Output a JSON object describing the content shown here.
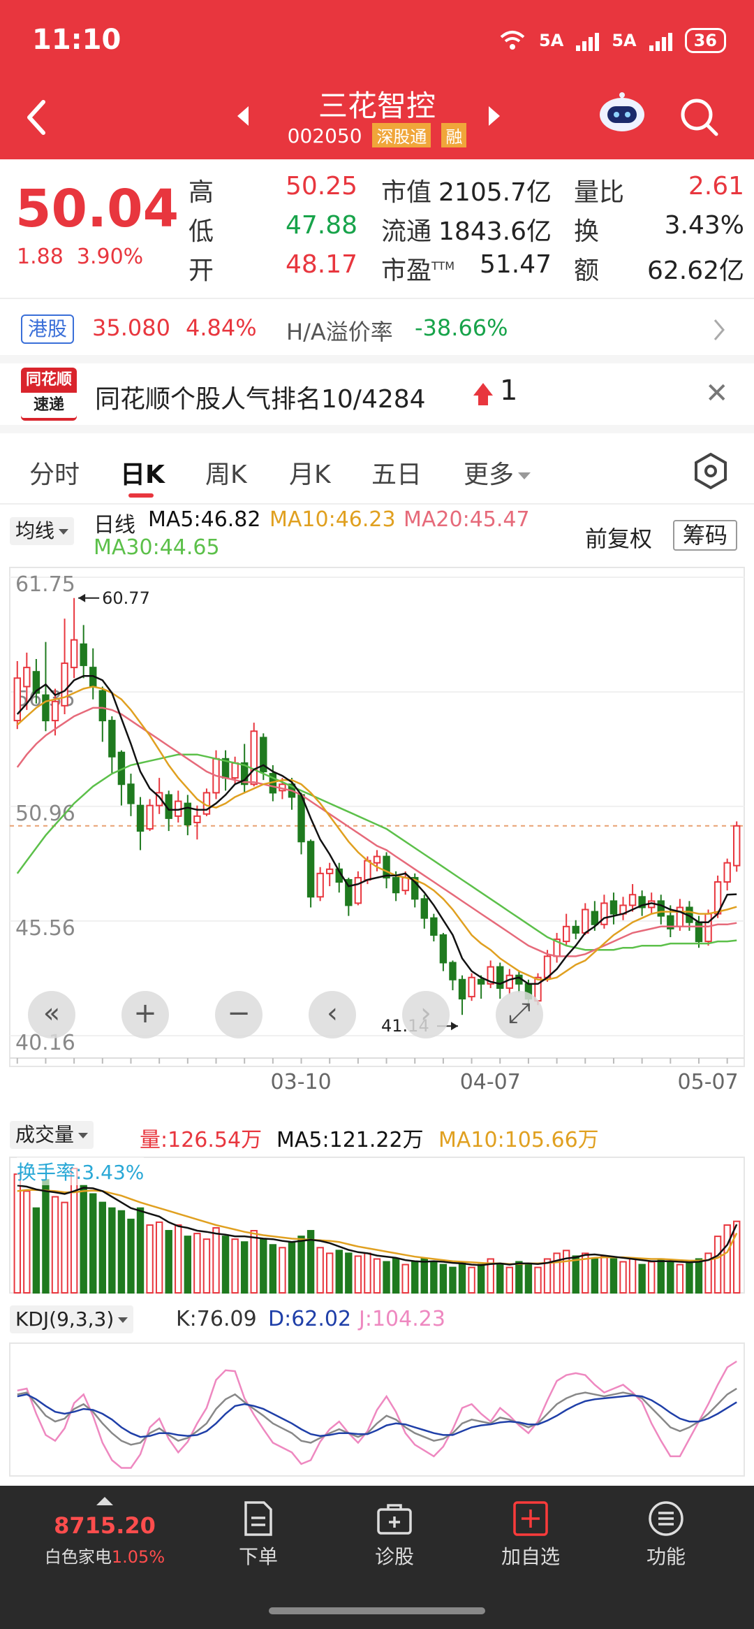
{
  "status": {
    "time": "11:10",
    "net1": "5A",
    "net2": "5A",
    "battery": "36"
  },
  "header": {
    "stock_name": "三花智控",
    "stock_code": "002050",
    "tag_connect": "深股通",
    "tag_margin": "融"
  },
  "quote": {
    "price": "50.04",
    "change": "1.88",
    "change_pct": "3.90%",
    "high_label": "高",
    "high": "50.25",
    "low_label": "低",
    "low": "47.88",
    "open_label": "开",
    "open": "48.17",
    "mktcap_label": "市值",
    "mktcap": "2105.7亿",
    "float_label": "流通",
    "float": "1843.6亿",
    "pe_label": "市盈",
    "pe_sup": "TTM",
    "pe": "51.47",
    "volratio_label": "量比",
    "volratio": "2.61",
    "turnover_label": "换",
    "turnover": "3.43%",
    "amount_label": "额",
    "amount": "62.62亿"
  },
  "hk": {
    "badge": "港股",
    "price": "35.080",
    "pct": "4.84%",
    "premium_label": "H/A溢价率",
    "premium": "-38.66%"
  },
  "popularity": {
    "logo_top": "同花顺",
    "logo_bottom": "速递",
    "text": "同花顺个股人气排名10/4284",
    "rank_change": "1"
  },
  "tabs": [
    "分时",
    "日K",
    "周K",
    "月K",
    "五日",
    "更多"
  ],
  "ma_legend": {
    "dropdown": "均线",
    "period": "日线",
    "ma5": "MA5:46.82",
    "ma10": "MA10:46.23",
    "ma20": "MA20:45.47",
    "ma30": "MA30:44.65",
    "adjust": "前复权",
    "chips": "筹码"
  },
  "colors": {
    "up": "#e8363e",
    "down": "#1f7a1f",
    "ma5": "#111111",
    "ma10": "#e0a020",
    "ma20": "#e66a7a",
    "ma30": "#5cc04a",
    "kdj_k": "#888888",
    "kdj_d": "#1f3fa8",
    "kdj_j": "#ee88c0"
  },
  "chart_data": [
    {
      "type": "candlestick",
      "title": "日线",
      "yticks": [
        "61.75",
        "56.35",
        "50.96",
        "45.56",
        "40.16"
      ],
      "ylim": [
        40.16,
        61.75
      ],
      "xticks": [
        "03-10",
        "04-07",
        "05-07"
      ],
      "high_marker": "60.77",
      "low_marker": "41.14",
      "last_close": 50.04,
      "candles": [
        [
          55.0,
          57.0,
          54.6,
          57.8
        ],
        [
          56.6,
          57.5,
          55.5,
          58.2
        ],
        [
          57.3,
          56.3,
          55.8,
          57.9
        ],
        [
          56.2,
          55.0,
          54.5,
          58.7
        ],
        [
          55.0,
          55.9,
          54.3,
          56.5
        ],
        [
          55.7,
          57.7,
          55.3,
          59.8
        ],
        [
          57.5,
          58.8,
          57.0,
          60.77
        ],
        [
          58.6,
          57.6,
          57.0,
          59.5
        ],
        [
          57.5,
          56.6,
          56.0,
          58.4
        ],
        [
          56.4,
          55.0,
          54.0,
          56.6
        ],
        [
          55.0,
          53.3,
          52.5,
          55.2
        ],
        [
          53.5,
          52.0,
          51.0,
          53.6
        ],
        [
          52.0,
          51.1,
          50.5,
          52.5
        ],
        [
          51.0,
          49.8,
          48.9,
          51.4
        ],
        [
          49.9,
          51.0,
          49.8,
          51.3
        ],
        [
          51.0,
          51.6,
          50.6,
          52.3
        ],
        [
          51.5,
          50.4,
          49.8,
          51.7
        ],
        [
          50.5,
          51.2,
          50.2,
          51.7
        ],
        [
          51.1,
          50.1,
          49.6,
          51.5
        ],
        [
          50.2,
          50.5,
          49.4,
          51.0
        ],
        [
          50.6,
          51.6,
          50.5,
          51.8
        ],
        [
          51.6,
          53.2,
          51.3,
          53.6
        ],
        [
          53.2,
          52.3,
          51.7,
          53.6
        ],
        [
          52.3,
          53.0,
          52.0,
          53.3
        ],
        [
          53.0,
          52.0,
          51.6,
          53.9
        ],
        [
          52.0,
          54.5,
          51.9,
          54.9
        ],
        [
          54.2,
          52.6,
          52.2,
          54.4
        ],
        [
          52.5,
          51.6,
          51.2,
          52.9
        ],
        [
          51.7,
          52.0,
          51.3,
          52.3
        ],
        [
          52.0,
          51.4,
          50.8,
          52.3
        ],
        [
          51.5,
          49.3,
          48.7,
          51.6
        ],
        [
          49.3,
          46.7,
          46.2,
          49.4
        ],
        [
          46.7,
          47.8,
          46.5,
          48.1
        ],
        [
          47.8,
          48.0,
          47.2,
          48.3
        ],
        [
          48.0,
          47.4,
          46.9,
          48.3
        ],
        [
          47.5,
          46.3,
          45.8,
          47.6
        ],
        [
          46.4,
          47.6,
          46.3,
          47.9
        ],
        [
          47.5,
          48.4,
          47.3,
          48.6
        ],
        [
          48.3,
          48.6,
          47.9,
          48.9
        ],
        [
          48.6,
          47.6,
          47.1,
          48.8
        ],
        [
          47.6,
          46.9,
          46.5,
          47.9
        ],
        [
          47.0,
          47.6,
          46.8,
          47.9
        ],
        [
          47.6,
          46.6,
          46.2,
          47.8
        ],
        [
          46.6,
          45.7,
          45.2,
          46.8
        ],
        [
          45.7,
          44.9,
          44.6,
          45.9
        ],
        [
          44.9,
          43.6,
          43.2,
          45.0
        ],
        [
          43.6,
          42.8,
          42.3,
          43.7
        ],
        [
          42.8,
          41.9,
          41.14,
          43.0
        ],
        [
          42.0,
          42.9,
          41.8,
          43.1
        ],
        [
          42.8,
          42.6,
          41.9,
          43.0
        ],
        [
          42.6,
          43.4,
          42.4,
          43.7
        ],
        [
          43.4,
          42.4,
          41.9,
          43.6
        ],
        [
          42.4,
          43.0,
          42.1,
          43.3
        ],
        [
          43.0,
          42.6,
          42.2,
          43.2
        ],
        [
          42.6,
          41.9,
          41.4,
          42.8
        ],
        [
          41.8,
          42.9,
          41.6,
          43.1
        ],
        [
          42.9,
          43.9,
          42.7,
          44.2
        ],
        [
          43.9,
          44.7,
          43.6,
          45.0
        ],
        [
          44.6,
          45.3,
          44.4,
          45.9
        ],
        [
          45.3,
          45.0,
          44.7,
          45.6
        ],
        [
          45.0,
          46.1,
          44.9,
          46.4
        ],
        [
          46.0,
          45.4,
          45.1,
          46.5
        ],
        [
          45.4,
          46.4,
          45.2,
          46.8
        ],
        [
          46.5,
          45.9,
          45.4,
          46.9
        ],
        [
          45.9,
          46.3,
          45.6,
          46.7
        ],
        [
          46.3,
          46.8,
          46.0,
          47.3
        ],
        [
          46.7,
          46.2,
          45.8,
          47.0
        ],
        [
          46.2,
          46.5,
          45.9,
          46.9
        ],
        [
          46.5,
          45.8,
          45.4,
          46.8
        ],
        [
          45.8,
          45.2,
          44.8,
          46.3
        ],
        [
          45.3,
          46.2,
          45.1,
          46.6
        ],
        [
          46.2,
          45.5,
          45.1,
          46.5
        ],
        [
          45.5,
          44.6,
          44.3,
          45.8
        ],
        [
          44.6,
          45.9,
          44.4,
          46.1
        ],
        [
          45.9,
          47.4,
          45.7,
          47.7
        ],
        [
          47.4,
          48.3,
          47.0,
          48.5
        ],
        [
          48.17,
          50.04,
          47.88,
          50.25
        ]
      ],
      "ma5": [
        55.3,
        55.8,
        56.4,
        56.7,
        56.2,
        56.4,
        56.9,
        57.1,
        57.1,
        56.9,
        56.3,
        55.1,
        53.9,
        52.6,
        51.8,
        51.4,
        50.8,
        50.8,
        50.9,
        50.8,
        50.8,
        51.1,
        51.5,
        52.0,
        52.2,
        52.7,
        52.9,
        52.6,
        52.4,
        52.1,
        51.5,
        50.4,
        49.4,
        48.7,
        47.9,
        47.2,
        47.3,
        47.5,
        47.6,
        47.7,
        47.7,
        47.8,
        47.4,
        46.9,
        46.3,
        45.6,
        44.9,
        43.8,
        43.2,
        42.9,
        42.7,
        42.6,
        42.8,
        42.9,
        42.6,
        42.6,
        42.9,
        43.3,
        43.9,
        44.4,
        45.0,
        45.3,
        45.7,
        45.8,
        45.9,
        46.1,
        46.3,
        46.4,
        46.3,
        46.1,
        46.0,
        45.8,
        45.5,
        45.5,
        45.9,
        46.8,
        46.82
      ],
      "ma10": [
        54.8,
        55.2,
        55.6,
        55.9,
        56.0,
        56.1,
        56.3,
        56.5,
        56.6,
        56.5,
        56.3,
        56.0,
        55.5,
        54.9,
        54.3,
        53.6,
        52.9,
        52.3,
        51.8,
        51.3,
        51.0,
        50.9,
        51.1,
        51.4,
        51.6,
        51.8,
        52.0,
        52.1,
        52.2,
        52.2,
        52.0,
        51.6,
        51.1,
        50.5,
        49.9,
        49.3,
        48.8,
        48.4,
        48.1,
        47.9,
        47.7,
        47.6,
        47.5,
        47.3,
        47.0,
        46.6,
        46.1,
        45.5,
        44.9,
        44.5,
        44.2,
        43.8,
        43.5,
        43.2,
        43.0,
        42.8,
        42.8,
        42.9,
        43.2,
        43.5,
        43.7,
        44.1,
        44.5,
        44.9,
        45.2,
        45.5,
        45.7,
        45.9,
        46.0,
        46.0,
        46.0,
        46.0,
        45.9,
        45.9,
        46.0,
        46.1,
        46.23
      ],
      "ma20": [
        52.8,
        53.4,
        53.9,
        54.3,
        54.6,
        54.9,
        55.2,
        55.4,
        55.6,
        55.6,
        55.5,
        55.3,
        55.0,
        54.7,
        54.4,
        54.1,
        53.8,
        53.5,
        53.2,
        52.9,
        52.6,
        52.4,
        52.3,
        52.2,
        52.1,
        52.1,
        52.0,
        51.9,
        51.8,
        51.7,
        51.5,
        51.2,
        50.9,
        50.6,
        50.3,
        50.0,
        49.7,
        49.4,
        49.1,
        48.9,
        48.6,
        48.3,
        48.0,
        47.7,
        47.4,
        47.1,
        46.8,
        46.5,
        46.2,
        45.9,
        45.6,
        45.3,
        45.0,
        44.7,
        44.4,
        44.2,
        44.0,
        43.9,
        43.9,
        43.9,
        44.0,
        44.2,
        44.4,
        44.6,
        44.8,
        45.0,
        45.1,
        45.2,
        45.3,
        45.3,
        45.3,
        45.3,
        45.3,
        45.3,
        45.4,
        45.4,
        45.47
      ],
      "ma30": [
        47.8,
        48.4,
        49.0,
        49.6,
        50.1,
        50.6,
        51.1,
        51.5,
        51.9,
        52.2,
        52.5,
        52.7,
        52.9,
        53.0,
        53.1,
        53.2,
        53.3,
        53.4,
        53.4,
        53.4,
        53.3,
        53.2,
        53.1,
        53.0,
        52.9,
        52.7,
        52.5,
        52.3,
        52.1,
        51.9,
        51.7,
        51.5,
        51.3,
        51.1,
        50.9,
        50.7,
        50.5,
        50.3,
        50.1,
        49.9,
        49.6,
        49.3,
        49.0,
        48.7,
        48.4,
        48.1,
        47.8,
        47.5,
        47.2,
        46.9,
        46.6,
        46.3,
        46.0,
        45.7,
        45.4,
        45.1,
        44.8,
        44.6,
        44.4,
        44.3,
        44.2,
        44.2,
        44.2,
        44.2,
        44.3,
        44.3,
        44.4,
        44.4,
        44.4,
        44.5,
        44.5,
        44.5,
        44.5,
        44.5,
        44.6,
        44.6,
        44.65
      ]
    },
    {
      "type": "bar",
      "title": "成交量",
      "legend": {
        "dropdown": "成交量",
        "vol": "量:126.54万",
        "ma5": "MA5:121.22万",
        "ma10": "MA10:105.66万",
        "turnover": "换手率:3.43%"
      },
      "values": [
        210,
        180,
        150,
        200,
        170,
        160,
        220,
        190,
        175,
        160,
        150,
        145,
        130,
        150,
        120,
        125,
        110,
        120,
        100,
        105,
        95,
        115,
        100,
        95,
        90,
        110,
        95,
        85,
        80,
        90,
        100,
        110,
        80,
        70,
        75,
        70,
        65,
        70,
        60,
        55,
        60,
        50,
        55,
        60,
        55,
        50,
        45,
        55,
        45,
        50,
        60,
        50,
        45,
        55,
        50,
        45,
        60,
        70,
        75,
        65,
        70,
        60,
        65,
        60,
        55,
        60,
        50,
        55,
        60,
        55,
        50,
        55,
        60,
        70,
        100,
        120,
        126.54
      ],
      "ma5": [
        190,
        188,
        183,
        180,
        178,
        175,
        180,
        186,
        185,
        180,
        170,
        160,
        150,
        145,
        140,
        135,
        125,
        118,
        115,
        110,
        108,
        105,
        103,
        100,
        100,
        98,
        96,
        95,
        92,
        90,
        92,
        94,
        92,
        88,
        82,
        76,
        72,
        70,
        66,
        64,
        62,
        58,
        56,
        55,
        56,
        55,
        53,
        52,
        50,
        49,
        51,
        52,
        50,
        52,
        52,
        51,
        53,
        57,
        61,
        63,
        67,
        68,
        66,
        64,
        62,
        60,
        58,
        56,
        56,
        56,
        55,
        54,
        55,
        58,
        66,
        85,
        121.22
      ],
      "ma10": [
        180,
        182,
        182,
        181,
        180,
        178,
        178,
        180,
        181,
        180,
        176,
        172,
        166,
        160,
        155,
        150,
        145,
        140,
        135,
        130,
        125,
        120,
        116,
        112,
        108,
        105,
        102,
        100,
        98,
        96,
        95,
        94,
        93,
        92,
        90,
        86,
        82,
        79,
        76,
        73,
        70,
        67,
        64,
        62,
        60,
        58,
        56,
        55,
        54,
        53,
        52,
        52,
        51,
        51,
        52,
        52,
        53,
        54,
        56,
        58,
        60,
        62,
        63,
        63,
        63,
        62,
        61,
        60,
        60,
        59,
        58,
        57,
        57,
        58,
        62,
        72,
        105.66
      ]
    },
    {
      "type": "line",
      "title": "KDJ(9,3,3)",
      "legend": {
        "dropdown": "KDJ(9,3,3)",
        "k": "K:76.09",
        "d": "D:62.02",
        "j": "J:104.23"
      },
      "k": [
        70,
        72,
        60,
        48,
        42,
        45,
        55,
        60,
        52,
        40,
        30,
        22,
        18,
        20,
        30,
        35,
        28,
        22,
        25,
        32,
        40,
        55,
        65,
        70,
        62,
        55,
        48,
        40,
        35,
        30,
        22,
        20,
        25,
        30,
        34,
        30,
        26,
        30,
        40,
        48,
        44,
        36,
        30,
        26,
        22,
        24,
        30,
        40,
        44,
        42,
        40,
        46,
        44,
        40,
        36,
        40,
        50,
        60,
        66,
        70,
        72,
        70,
        68,
        70,
        72,
        70,
        66,
        56,
        46,
        36,
        32,
        36,
        42,
        50,
        60,
        70,
        76.09
      ],
      "d": [
        68,
        70,
        65,
        58,
        52,
        50,
        52,
        55,
        54,
        50,
        44,
        36,
        30,
        26,
        27,
        30,
        30,
        28,
        27,
        28,
        32,
        40,
        50,
        58,
        60,
        58,
        55,
        50,
        45,
        40,
        34,
        29,
        27,
        28,
        30,
        30,
        29,
        29,
        33,
        38,
        40,
        39,
        36,
        33,
        30,
        28,
        28,
        32,
        36,
        38,
        39,
        41,
        42,
        41,
        39,
        39,
        43,
        48,
        54,
        59,
        63,
        65,
        66,
        67,
        68,
        69,
        68,
        64,
        58,
        51,
        45,
        42,
        42,
        45,
        50,
        56,
        62.02
      ],
      "j": [
        74,
        76,
        50,
        28,
        22,
        35,
        61,
        70,
        48,
        20,
        2,
        -6,
        -6,
        8,
        36,
        45,
        24,
        10,
        21,
        40,
        56,
        85,
        95,
        94,
        66,
        49,
        34,
        20,
        15,
        10,
        -2,
        2,
        21,
        34,
        42,
        30,
        20,
        32,
        54,
        68,
        52,
        30,
        18,
        12,
        6,
        16,
        34,
        56,
        60,
        50,
        42,
        56,
        48,
        38,
        30,
        42,
        64,
        84,
        90,
        92,
        90,
        80,
        72,
        76,
        80,
        72,
        62,
        40,
        22,
        6,
        6,
        24,
        42,
        60,
        80,
        98,
        104.23
      ]
    }
  ],
  "controls": [
    "«",
    "+",
    "−",
    "‹",
    "›",
    "⤢"
  ],
  "bottom": {
    "index_value": "8715.20",
    "index_name": "白色家电",
    "index_pct": "1.05%",
    "items": [
      "下单",
      "诊股",
      "加自选",
      "功能"
    ]
  }
}
